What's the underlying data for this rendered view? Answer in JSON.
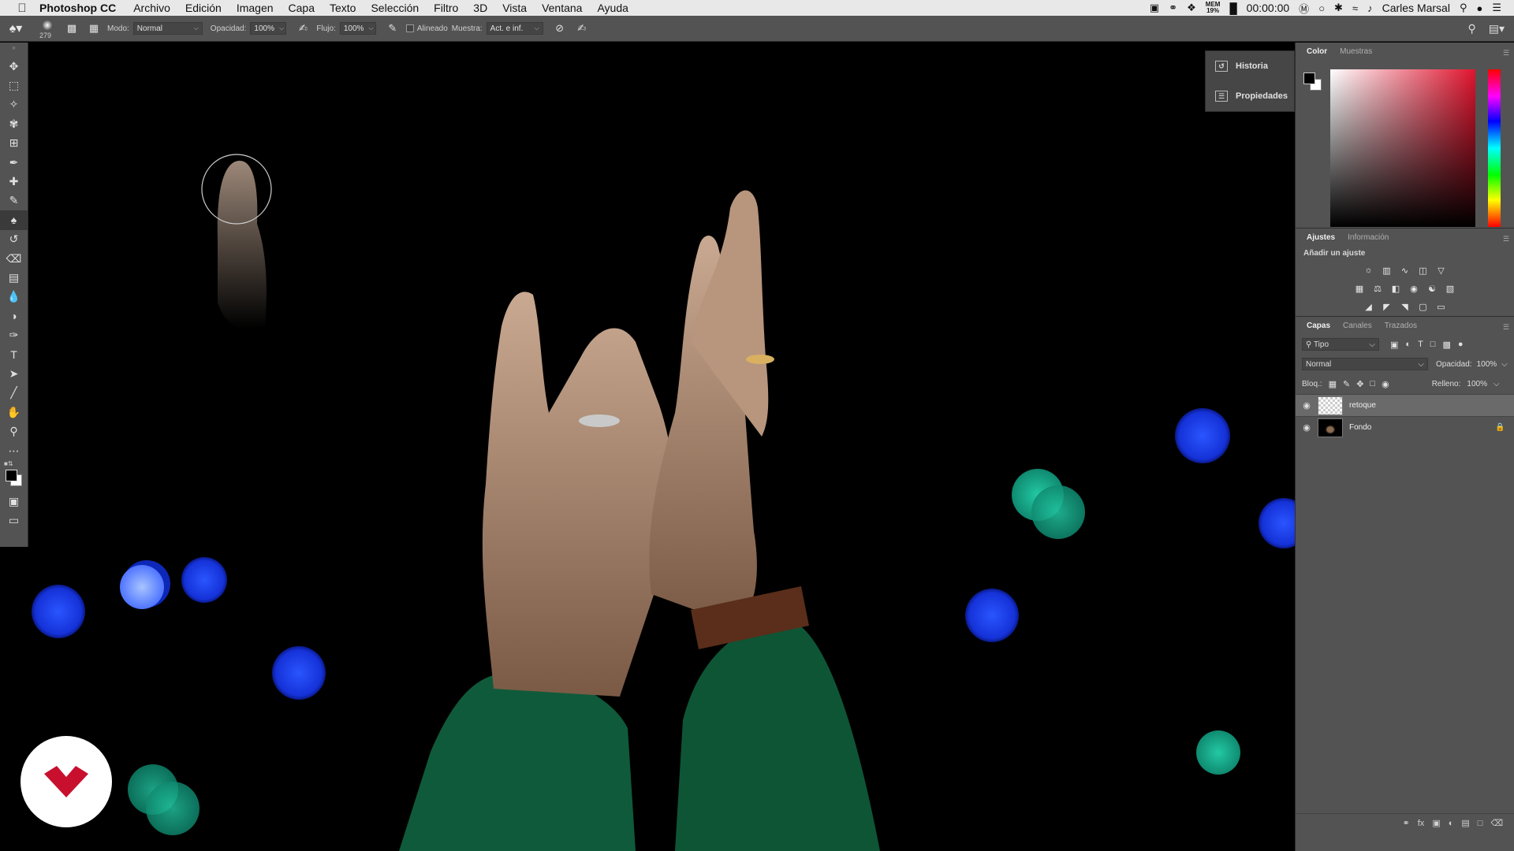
{
  "menubar": {
    "app_name": "Photoshop CC",
    "items": [
      "Archivo",
      "Edición",
      "Imagen",
      "Capa",
      "Texto",
      "Selección",
      "Filtro",
      "3D",
      "Vista",
      "Ventana",
      "Ayuda"
    ],
    "mem_label": "MEM",
    "mem_value": "19%",
    "clock": "00:00:00",
    "user": "Carles Marsal"
  },
  "options": {
    "brush_size": "279",
    "mode_label": "Modo:",
    "mode_value": "Normal",
    "opacity_label": "Opacidad:",
    "opacity_value": "100%",
    "flow_label": "Flujo:",
    "flow_value": "100%",
    "aligned_label": "Alineado",
    "sample_label": "Muestra:",
    "sample_value": "Act. e inf."
  },
  "collapsed_panels": {
    "history": "Historia",
    "properties": "Propiedades"
  },
  "color_panel": {
    "tab_color": "Color",
    "tab_swatches": "Muestras"
  },
  "adjust_panel": {
    "tab_adjust": "Ajustes",
    "tab_info": "Información",
    "hint": "Añadir un ajuste"
  },
  "layers_panel": {
    "tab_layers": "Capas",
    "tab_channels": "Canales",
    "tab_paths": "Trazados",
    "filter_value": "Tipo",
    "blend_value": "Normal",
    "opacity_label": "Opacidad:",
    "opacity_value": "100%",
    "lock_label": "Bloq.:",
    "fill_label": "Relleno:",
    "fill_value": "100%",
    "layers": [
      {
        "name": "retoque"
      },
      {
        "name": "Fondo"
      }
    ]
  },
  "colors": {
    "chrome": "#535353",
    "menubar": "#e9e8e8",
    "accent_red": "#e0142e"
  }
}
